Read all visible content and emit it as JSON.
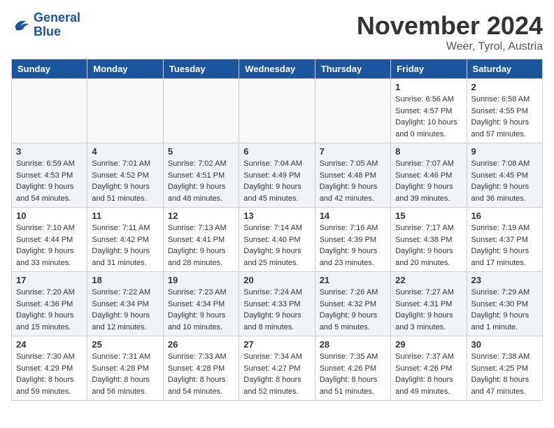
{
  "header": {
    "logo_line1": "General",
    "logo_line2": "Blue",
    "month": "November 2024",
    "location": "Weer, Tyrol, Austria"
  },
  "weekdays": [
    "Sunday",
    "Monday",
    "Tuesday",
    "Wednesday",
    "Thursday",
    "Friday",
    "Saturday"
  ],
  "weeks": [
    [
      {
        "day": "",
        "info": ""
      },
      {
        "day": "",
        "info": ""
      },
      {
        "day": "",
        "info": ""
      },
      {
        "day": "",
        "info": ""
      },
      {
        "day": "",
        "info": ""
      },
      {
        "day": "1",
        "info": "Sunrise: 6:56 AM\nSunset: 4:57 PM\nDaylight: 10 hours and 0 minutes."
      },
      {
        "day": "2",
        "info": "Sunrise: 6:58 AM\nSunset: 4:55 PM\nDaylight: 9 hours and 57 minutes."
      }
    ],
    [
      {
        "day": "3",
        "info": "Sunrise: 6:59 AM\nSunset: 4:53 PM\nDaylight: 9 hours and 54 minutes."
      },
      {
        "day": "4",
        "info": "Sunrise: 7:01 AM\nSunset: 4:52 PM\nDaylight: 9 hours and 51 minutes."
      },
      {
        "day": "5",
        "info": "Sunrise: 7:02 AM\nSunset: 4:51 PM\nDaylight: 9 hours and 48 minutes."
      },
      {
        "day": "6",
        "info": "Sunrise: 7:04 AM\nSunset: 4:49 PM\nDaylight: 9 hours and 45 minutes."
      },
      {
        "day": "7",
        "info": "Sunrise: 7:05 AM\nSunset: 4:48 PM\nDaylight: 9 hours and 42 minutes."
      },
      {
        "day": "8",
        "info": "Sunrise: 7:07 AM\nSunset: 4:46 PM\nDaylight: 9 hours and 39 minutes."
      },
      {
        "day": "9",
        "info": "Sunrise: 7:08 AM\nSunset: 4:45 PM\nDaylight: 9 hours and 36 minutes."
      }
    ],
    [
      {
        "day": "10",
        "info": "Sunrise: 7:10 AM\nSunset: 4:44 PM\nDaylight: 9 hours and 33 minutes."
      },
      {
        "day": "11",
        "info": "Sunrise: 7:11 AM\nSunset: 4:42 PM\nDaylight: 9 hours and 31 minutes."
      },
      {
        "day": "12",
        "info": "Sunrise: 7:13 AM\nSunset: 4:41 PM\nDaylight: 9 hours and 28 minutes."
      },
      {
        "day": "13",
        "info": "Sunrise: 7:14 AM\nSunset: 4:40 PM\nDaylight: 9 hours and 25 minutes."
      },
      {
        "day": "14",
        "info": "Sunrise: 7:16 AM\nSunset: 4:39 PM\nDaylight: 9 hours and 23 minutes."
      },
      {
        "day": "15",
        "info": "Sunrise: 7:17 AM\nSunset: 4:38 PM\nDaylight: 9 hours and 20 minutes."
      },
      {
        "day": "16",
        "info": "Sunrise: 7:19 AM\nSunset: 4:37 PM\nDaylight: 9 hours and 17 minutes."
      }
    ],
    [
      {
        "day": "17",
        "info": "Sunrise: 7:20 AM\nSunset: 4:36 PM\nDaylight: 9 hours and 15 minutes."
      },
      {
        "day": "18",
        "info": "Sunrise: 7:22 AM\nSunset: 4:34 PM\nDaylight: 9 hours and 12 minutes."
      },
      {
        "day": "19",
        "info": "Sunrise: 7:23 AM\nSunset: 4:34 PM\nDaylight: 9 hours and 10 minutes."
      },
      {
        "day": "20",
        "info": "Sunrise: 7:24 AM\nSunset: 4:33 PM\nDaylight: 9 hours and 8 minutes."
      },
      {
        "day": "21",
        "info": "Sunrise: 7:26 AM\nSunset: 4:32 PM\nDaylight: 9 hours and 5 minutes."
      },
      {
        "day": "22",
        "info": "Sunrise: 7:27 AM\nSunset: 4:31 PM\nDaylight: 9 hours and 3 minutes."
      },
      {
        "day": "23",
        "info": "Sunrise: 7:29 AM\nSunset: 4:30 PM\nDaylight: 9 hours and 1 minute."
      }
    ],
    [
      {
        "day": "24",
        "info": "Sunrise: 7:30 AM\nSunset: 4:29 PM\nDaylight: 8 hours and 59 minutes."
      },
      {
        "day": "25",
        "info": "Sunrise: 7:31 AM\nSunset: 4:28 PM\nDaylight: 8 hours and 56 minutes."
      },
      {
        "day": "26",
        "info": "Sunrise: 7:33 AM\nSunset: 4:28 PM\nDaylight: 8 hours and 54 minutes."
      },
      {
        "day": "27",
        "info": "Sunrise: 7:34 AM\nSunset: 4:27 PM\nDaylight: 8 hours and 52 minutes."
      },
      {
        "day": "28",
        "info": "Sunrise: 7:35 AM\nSunset: 4:26 PM\nDaylight: 8 hours and 51 minutes."
      },
      {
        "day": "29",
        "info": "Sunrise: 7:37 AM\nSunset: 4:26 PM\nDaylight: 8 hours and 49 minutes."
      },
      {
        "day": "30",
        "info": "Sunrise: 7:38 AM\nSunset: 4:25 PM\nDaylight: 8 hours and 47 minutes."
      }
    ]
  ]
}
